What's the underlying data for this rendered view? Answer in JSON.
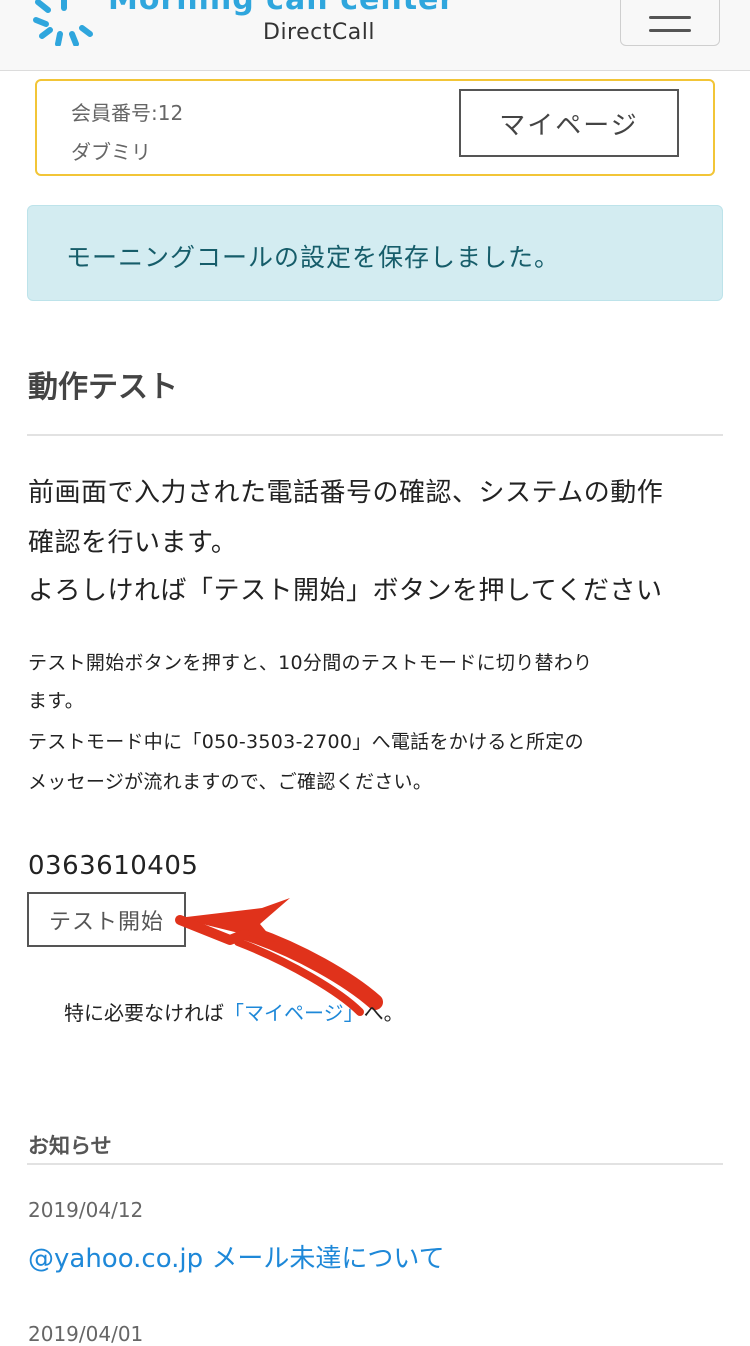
{
  "header": {
    "logo_title": "Morning call center",
    "logo_sub": "DirectCall",
    "logo_icon": "sunburst-logo-icon",
    "menu_icon": "hamburger-menu-icon"
  },
  "member": {
    "number": "会員番号:12",
    "name": "ダブミリ",
    "mypage_label": "マイページ"
  },
  "alert": {
    "message": "モーニングコールの設定を保存しました。"
  },
  "section": {
    "title": "動作テスト",
    "desc_line1": "前画面で入力された電話番号の確認、システムの動作",
    "desc_line2": "確認を行います。",
    "desc_line3": "よろしければ「テスト開始」ボタンを押してください",
    "note_line1": "テスト開始ボタンを押すと、10分間のテストモードに切り替わり",
    "note_line2": "ます。",
    "note_line3": "テストモード中に「050-3503-2700」へ電話をかけると所定の",
    "note_line4": "メッセージが流れますので、ご確認ください。",
    "phone": "0363610405",
    "test_button": "テスト開始",
    "hint_prefix": "特に必要なければ",
    "hint_link": "「マイページ」",
    "hint_suffix": "へ。"
  },
  "news": {
    "title": "お知らせ",
    "items": [
      {
        "date": "2019/04/12",
        "title": "@yahoo.co.jp メール未達について"
      },
      {
        "date": "2019/04/01"
      }
    ]
  },
  "colors": {
    "brand_blue": "#2fa6dd",
    "link_blue": "#1e88d8",
    "member_border": "#f2c537",
    "alert_bg": "#d3ecf1",
    "alert_text": "#165d6a",
    "annotation_arrow": "#e0321b"
  }
}
